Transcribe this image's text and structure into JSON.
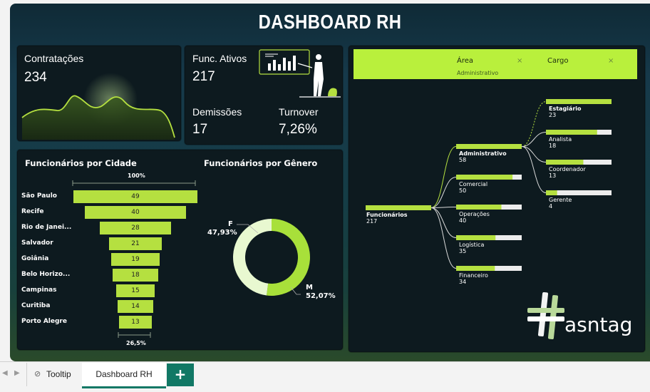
{
  "dashboard": {
    "title": "DASHBOARD RH"
  },
  "kpis": {
    "contratacoes": {
      "label": "Contratações",
      "value": "234"
    },
    "ativos": {
      "label": "Func. Ativos",
      "value": "217"
    },
    "demissoes": {
      "label": "Demissões",
      "value": "17"
    },
    "turnover": {
      "label": "Turnover",
      "value": "7,26%"
    }
  },
  "funnel": {
    "title": "Funcionários por Cidade",
    "top_label": "100%",
    "bottom_label": "26,5%",
    "cities": [
      {
        "label": "São Paulo",
        "value": 49
      },
      {
        "label": "Recife",
        "value": 40
      },
      {
        "label": "Rio de Janei...",
        "value": 28
      },
      {
        "label": "Salvador",
        "value": 21
      },
      {
        "label": "Goiânia",
        "value": 19
      },
      {
        "label": "Belo Horizo...",
        "value": 18
      },
      {
        "label": "Campinas",
        "value": 15
      },
      {
        "label": "Curitiba",
        "value": 14
      },
      {
        "label": "Porto Alegre",
        "value": 13
      }
    ]
  },
  "gender": {
    "title": "Funcionários por Gênero",
    "f_label": "F",
    "f_value": "47,93%",
    "m_label": "M",
    "m_value": "52,07%",
    "f_fraction": 0.4793,
    "colors": {
      "f": "#e8f8d0",
      "m": "#a8e03a"
    }
  },
  "filters": {
    "area": {
      "label": "Área",
      "value": "Administrativo"
    },
    "cargo": {
      "label": "Cargo"
    },
    "clear_symbol": "×"
  },
  "tree": {
    "root": {
      "label": "Funcionários",
      "value": "217"
    },
    "areas": [
      {
        "label": "Administrativo",
        "value": "58",
        "fraction": 1.0,
        "selected": true
      },
      {
        "label": "Comercial",
        "value": "50",
        "fraction": 0.86
      },
      {
        "label": "Operações",
        "value": "40",
        "fraction": 0.69
      },
      {
        "label": "Logística",
        "value": "35",
        "fraction": 0.6
      },
      {
        "label": "Financeiro",
        "value": "34",
        "fraction": 0.59
      }
    ],
    "cargos": [
      {
        "label": "Estagiário",
        "value": "23",
        "fraction": 1.0,
        "selected": true
      },
      {
        "label": "Analista",
        "value": "18",
        "fraction": 0.78
      },
      {
        "label": "Coordenador",
        "value": "13",
        "fraction": 0.57
      },
      {
        "label": "Gerente",
        "value": "4",
        "fraction": 0.17
      }
    ]
  },
  "brand": {
    "logo_text": "asntag"
  },
  "tabs": {
    "tooltip": "Tooltip",
    "dashboard": "Dashboard RH",
    "add": "+"
  },
  "colors": {
    "accent": "#b5e040",
    "dark": "#0d1a1f",
    "tab_accent": "#117865"
  }
}
